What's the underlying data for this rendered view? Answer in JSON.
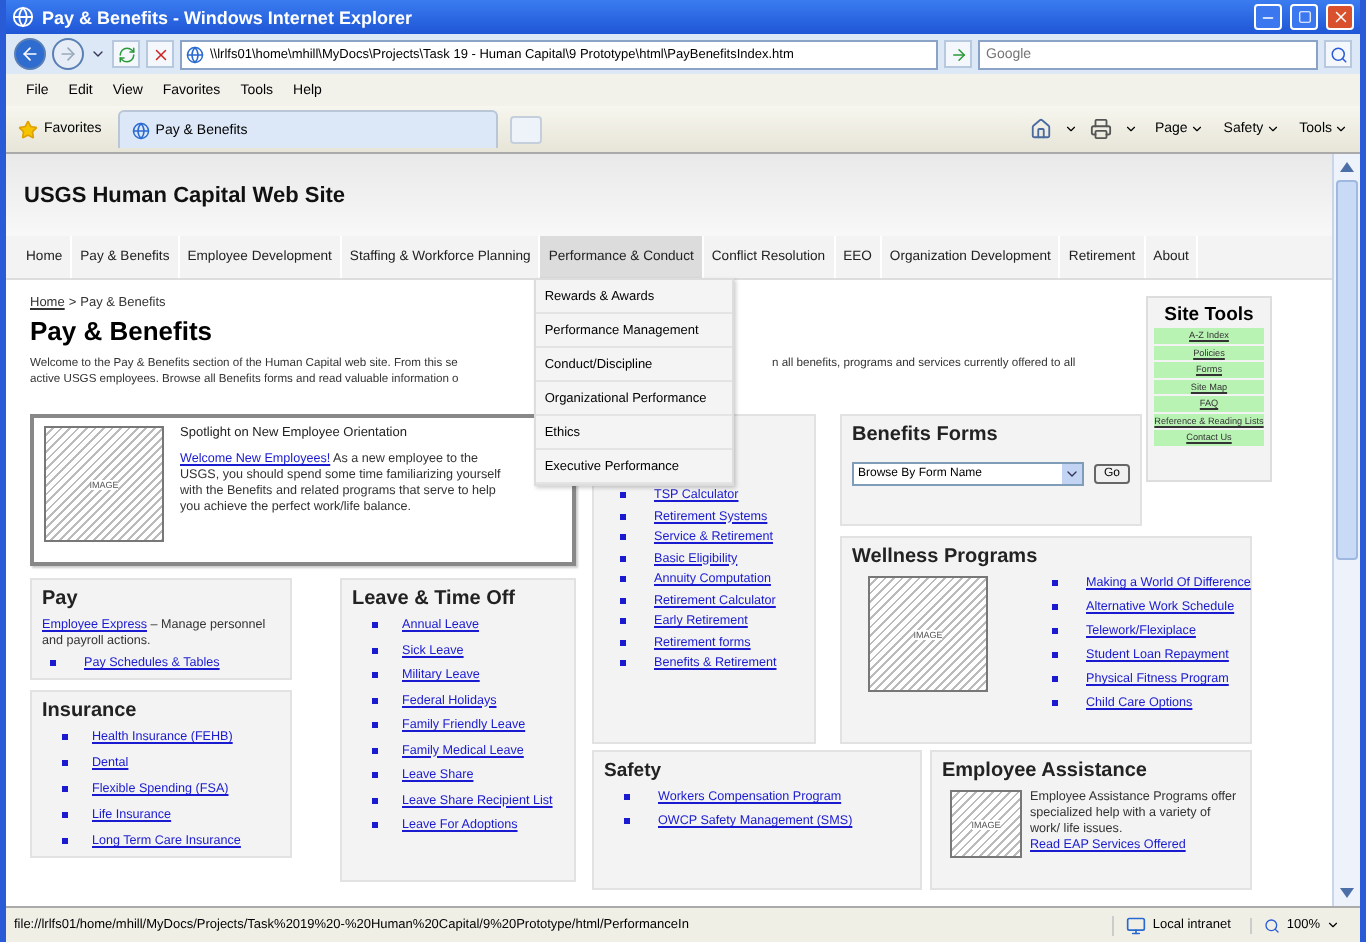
{
  "window": {
    "title": "Pay & Benefits - Windows Internet Explorer"
  },
  "address_bar": {
    "url": "\\\\lrlfs01\\home\\mhill\\MyDocs\\Projects\\Task 19 - Human Capital\\9 Prototype\\html\\PayBenefitsIndex.htm",
    "search_placeholder": "Google"
  },
  "menu_bar": [
    "File",
    "Edit",
    "View",
    "Favorites",
    "Tools",
    "Help"
  ],
  "favorites_bar": {
    "favorites": "Favorites",
    "tabs": [
      {
        "label": "Pay & Benefits",
        "selected": true
      }
    ],
    "commands": [
      "Page",
      "Safety",
      "Tools"
    ]
  },
  "site": {
    "title": "USGS Human Capital Web Site",
    "nav": [
      {
        "label": "Home",
        "selected": false
      },
      {
        "label": "Pay & Benefits",
        "selected": false
      },
      {
        "label": "Employee Development",
        "selected": false
      },
      {
        "label": "Staffing & Workforce Planning",
        "selected": false
      },
      {
        "label": "Performance & Conduct",
        "selected": true
      },
      {
        "label": "Conflict Resolution",
        "selected": false
      },
      {
        "label": "EEO",
        "selected": false
      },
      {
        "label": "Organization Development",
        "selected": false
      },
      {
        "label": "Retirement",
        "selected": false
      },
      {
        "label": "About",
        "selected": false
      }
    ],
    "nav_menu": [
      "Rewards & Awards",
      "Performance Management",
      "Conduct/Discipline",
      "Organizational Performance",
      "Ethics",
      "Executive Performance"
    ]
  },
  "breadcrumb": {
    "items": [
      "Home",
      "Pay & Benefits"
    ],
    "separator": ">"
  },
  "heading": "Pay & Benefits",
  "intro": {
    "left": [
      "Welcome to the Pay & Benefits section of the Human Capital web site. From this se",
      "active USGS employees. Browse all Benefits forms and read valuable information o"
    ],
    "right": "n all benefits, programs and services currently offered to all"
  },
  "spotlight": {
    "image_label": "IMAGE",
    "title": "Spotlight on New Employee Orientation",
    "link": "Welcome New Employees!",
    "text": " As a new employee to the USGS, you should spend some time familiarizing yourself with the Benefits and related  programs that serve to help you achieve the perfect work/life balance."
  },
  "pay": {
    "title": "Pay",
    "link": "Employee Express",
    "text": " – Manage personnel and payroll actions.",
    "items": [
      "Pay Schedules & Tables"
    ]
  },
  "insurance": {
    "title": "Insurance",
    "items": [
      "Health Insurance (FEHB)",
      "Dental",
      "Flexible Spending (FSA)",
      "Life Insurance",
      "Long Term Care Insurance"
    ]
  },
  "leave": {
    "title": "Leave & Time Off",
    "items": [
      "Annual Leave",
      "Sick Leave",
      "Military Leave",
      "Federal Holidays",
      "Family Friendly Leave",
      "Family Medical Leave",
      "Leave Share",
      "Leave Share Recipient List",
      "Leave For Adoptions"
    ]
  },
  "retirement": {
    "items": [
      "TSP Calculator",
      "Retirement Systems",
      "Service & Retirement",
      "Basic Eligibility",
      "Annuity Computation",
      "Retirement Calculator",
      "Early Retirement",
      "Retirement forms",
      "Benefits & Retirement"
    ]
  },
  "benefits_forms": {
    "title": "Benefits Forms",
    "select": "Browse By Form Name",
    "button": "Go"
  },
  "site_tools": {
    "title": "Site Tools",
    "items": [
      "A-Z Index",
      "Policies",
      "Forms",
      "Site Map",
      "FAQ",
      "Reference & Reading Lists",
      "Contact Us"
    ]
  },
  "wellness": {
    "title": "Wellness Programs",
    "image_label": "IMAGE",
    "items": [
      "Making a World Of Difference",
      "Alternative Work Schedule",
      "Telework/Flexiplace",
      "Student Loan Repayment",
      "Physical Fitness Program",
      "Child Care Options"
    ]
  },
  "safety": {
    "title": "Safety",
    "items": [
      "Workers Compensation Program",
      "OWCP Safety Management (SMS)"
    ]
  },
  "employee_assistance": {
    "title": "Employee Assistance",
    "image_label": "IMAGE",
    "text": "Employee Assistance Programs offer specialized help with a variety of work/ life issues. ",
    "link": "Read EAP Services Offered"
  },
  "status_bar": {
    "url": "file://lrlfs01/home/mhill/MyDocs/Projects/Task%2019%20-%20Human%20Capital/9%20Prototype/html/PerformanceIn",
    "zone": "Local intranet",
    "zoom": "100%"
  }
}
